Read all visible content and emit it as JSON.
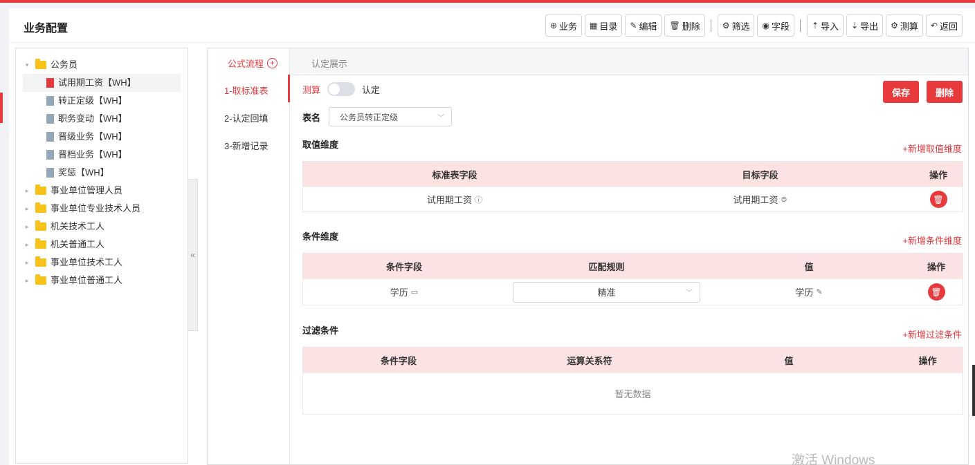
{
  "page_title": "业务配置",
  "toolbar": [
    {
      "name": "business-button",
      "icon": "plus-circle-icon",
      "glyph": "⊕",
      "label": "业务"
    },
    {
      "name": "catalog-button",
      "icon": "grid-icon",
      "glyph": "▦",
      "label": "目录"
    },
    {
      "name": "edit-button",
      "icon": "pencil-icon",
      "glyph": "✎",
      "label": "编辑"
    },
    {
      "name": "delete-button",
      "icon": "trash-icon",
      "glyph": "🗑",
      "label": "删除"
    },
    {
      "sep": true
    },
    {
      "name": "filter-button",
      "icon": "gear-icon",
      "glyph": "⚙",
      "label": "筛选"
    },
    {
      "name": "field-button",
      "icon": "eye-icon",
      "glyph": "◉",
      "label": "字段"
    },
    {
      "sep": true
    },
    {
      "name": "import-button",
      "icon": "upload-icon",
      "glyph": "⇡",
      "label": "导入"
    },
    {
      "name": "export-button",
      "icon": "download-icon",
      "glyph": "⇣",
      "label": "导出"
    },
    {
      "name": "calculate-button",
      "icon": "gear-icon",
      "glyph": "⚙",
      "label": "测算"
    },
    {
      "name": "back-button",
      "icon": "undo-icon",
      "glyph": "↶",
      "label": "返回"
    }
  ],
  "tree": [
    {
      "label": "公务员",
      "type": "folder",
      "expanded": true,
      "level": 0
    },
    {
      "label": "试用期工资【WH】",
      "type": "doc",
      "selected": true,
      "level": 1
    },
    {
      "label": "转正定级【WH】",
      "type": "doc",
      "level": 1
    },
    {
      "label": "职务变动【WH】",
      "type": "doc",
      "level": 1
    },
    {
      "label": "晋级业务【WH】",
      "type": "doc",
      "level": 1
    },
    {
      "label": "晋档业务【WH】",
      "type": "doc",
      "level": 1
    },
    {
      "label": "奖惩【WH】",
      "type": "doc",
      "level": 1
    },
    {
      "label": "事业单位管理人员",
      "type": "folder",
      "level": 0
    },
    {
      "label": "事业单位专业技术人员",
      "type": "folder",
      "level": 0
    },
    {
      "label": "机关技术工人",
      "type": "folder",
      "level": 0
    },
    {
      "label": "机关普通工人",
      "type": "folder",
      "level": 0
    },
    {
      "label": "事业单位技术工人",
      "type": "folder",
      "level": 0
    },
    {
      "label": "事业单位普通工人",
      "type": "folder",
      "level": 0
    }
  ],
  "collapse_glyph": "«",
  "steps": {
    "header": "公式流程",
    "items": [
      "1-取标准表",
      "2-认定回填",
      "3-新增记录"
    ],
    "active_index": 0
  },
  "tab_label": "认定展示",
  "mode": {
    "left": "测算",
    "right": "认定",
    "on": false
  },
  "buttons": {
    "save": "保存",
    "delete": "删除"
  },
  "form": {
    "table_label": "表名",
    "table_value": "公务员转正定级"
  },
  "value_dimension": {
    "title": "取值维度",
    "add_label": "+新增取值维度",
    "columns": [
      "标准表字段",
      "目标字段",
      "操作"
    ],
    "rows": [
      {
        "source": "试用期工资",
        "target": "试用期工资"
      }
    ]
  },
  "condition_dimension": {
    "title": "条件维度",
    "add_label": "+新增条件维度",
    "columns": [
      "条件字段",
      "匹配规则",
      "值",
      "操作"
    ],
    "rows": [
      {
        "field": "学历",
        "rule": "精准",
        "value": "学历"
      }
    ]
  },
  "filter_conditions": {
    "title": "过滤条件",
    "add_label": "+新增过滤条件",
    "columns": [
      "条件字段",
      "运算关系符",
      "值",
      "操作"
    ],
    "empty_text": "暂无数据"
  },
  "watermark": "激活 Windows",
  "colors": {
    "accent": "#e8393d",
    "header_bg": "#fde2e3",
    "folder": "#f7c21a"
  }
}
